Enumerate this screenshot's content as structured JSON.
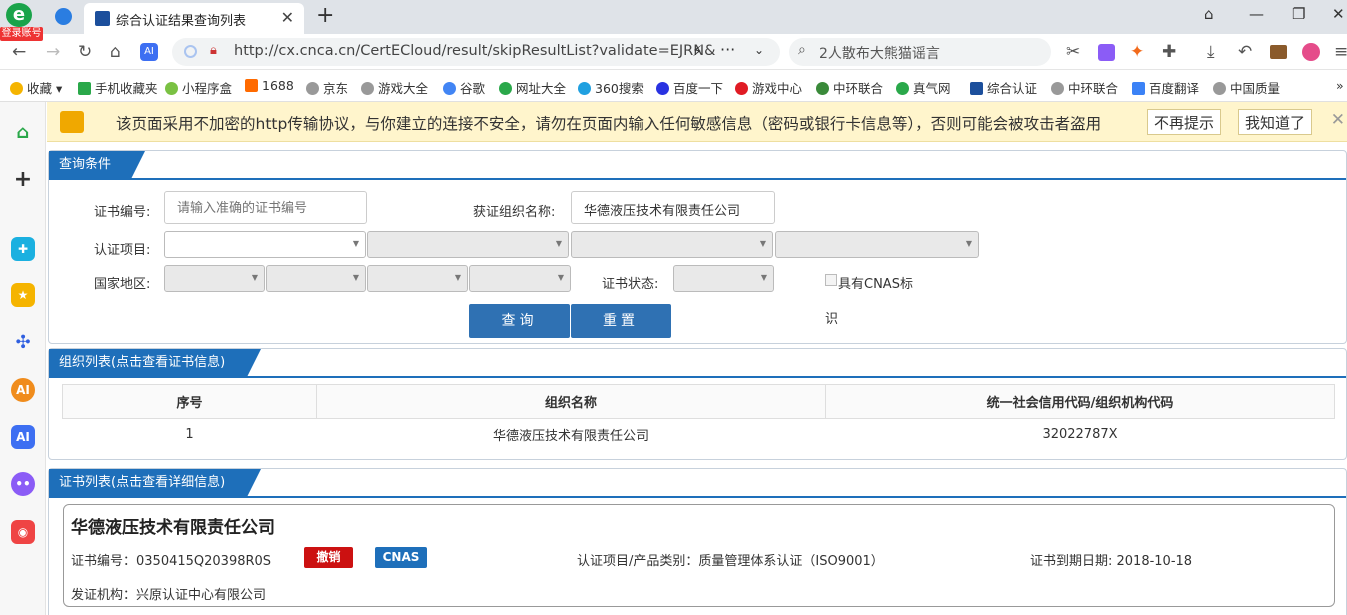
{
  "browser": {
    "login_badge": "登录账号",
    "tab_title": "综合认证结果查询列表",
    "url": "http://cx.cnca.cn/CertECloud/result/skipResultList?validate=EJRN&",
    "search_query": "2人散布大熊猫谣言",
    "bookmarks": [
      "收藏",
      "手机收藏夹",
      "小程序盒",
      "1688",
      "京东",
      "游戏大全",
      "谷歌",
      "网址大全",
      "360搜索",
      "百度一下",
      "游戏中心",
      "中环联合",
      "真气网",
      "综合认证",
      "中环联合",
      "百度翻译",
      "中国质量"
    ]
  },
  "warning": {
    "message": "该页面采用不加密的http传输协议，与你建立的连接不安全，请勿在页面内输入任何敏感信息（密码或银行卡信息等），否则可能会被攻击者盗用",
    "dont_remind": "不再提示",
    "got_it": "我知道了"
  },
  "query": {
    "header": "查询条件",
    "cert_no_label": "证书编号:",
    "cert_no_placeholder": "请输入准确的证书编号",
    "org_label": "获证组织名称:",
    "org_value": "华德液压技术有限责任公司",
    "project_label": "认证项目:",
    "region_label": "国家地区:",
    "status_label": "证书状态:",
    "cnas_label": "具有CNAS标",
    "cnas_label2": "识",
    "search_btn": "查询",
    "reset_btn": "重置"
  },
  "orgs": {
    "header": "组织列表(点击查看证书信息)",
    "columns": [
      "序号",
      "组织名称",
      "统一社会信用代码/组织机构代码"
    ],
    "rows": [
      [
        "1",
        "华德液压技术有限责任公司",
        "32022787X"
      ]
    ]
  },
  "certs": {
    "header": "证书列表(点击查看详细信息)",
    "company": "华德液压技术有限责任公司",
    "cert_no": "证书编号：0350415Q20398R0S",
    "revoked_tag": "撤销",
    "cnas_tag": "CNAS",
    "project": "认证项目/产品类别：质量管理体系认证（ISO9001）",
    "expiry": "证书到期日期: 2018-10-18",
    "issuer": "发证机构：兴原认证中心有限公司"
  }
}
